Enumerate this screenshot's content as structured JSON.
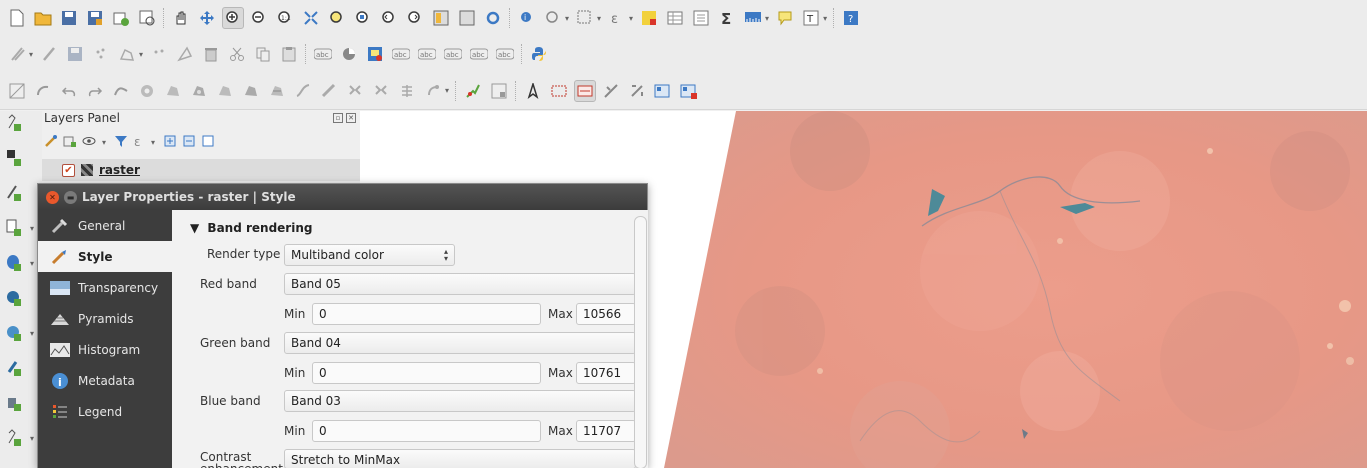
{
  "layers_panel": {
    "title": "Layers Panel",
    "layer_name": "raster"
  },
  "dialog": {
    "title": "Layer Properties - raster | Style",
    "sidebar": [
      {
        "label": "General",
        "icon": "wrench-icon"
      },
      {
        "label": "Style",
        "icon": "paintbrush-icon"
      },
      {
        "label": "Transparency",
        "icon": "transparency-icon"
      },
      {
        "label": "Pyramids",
        "icon": "pyramids-icon"
      },
      {
        "label": "Histogram",
        "icon": "histogram-icon"
      },
      {
        "label": "Metadata",
        "icon": "info-icon"
      },
      {
        "label": "Legend",
        "icon": "legend-icon"
      }
    ],
    "active_tab": "Style",
    "band_rendering": {
      "section_title": "Band rendering",
      "render_type_label": "Render type",
      "render_type_value": "Multiband color",
      "red_label": "Red band",
      "red_value": "Band 05",
      "red_min": "0",
      "red_max": "10566",
      "green_label": "Green band",
      "green_value": "Band 04",
      "green_min": "0",
      "green_max": "10761",
      "blue_label": "Blue band",
      "blue_value": "Band 03",
      "blue_min": "0",
      "blue_max": "11707",
      "min_label": "Min",
      "max_label": "Max",
      "contrast_label": "Contrast enhancement",
      "contrast_value": "Stretch to MinMax"
    }
  },
  "colors": {
    "raster_fill": "#e59b8c",
    "dialog_sidebar": "#3d3d3d",
    "title_bar": "#464646"
  }
}
